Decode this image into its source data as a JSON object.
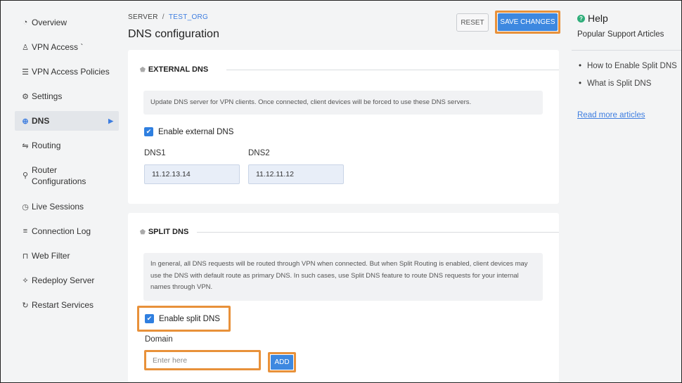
{
  "sidebar": {
    "items": [
      {
        "label": "Overview",
        "icon": "overview-icon",
        "glyph": "◔"
      },
      {
        "label": "VPN Access `",
        "icon": "user-icon",
        "glyph": "♙"
      },
      {
        "label": "VPN Access Policies",
        "icon": "list-icon",
        "glyph": "☰"
      },
      {
        "label": "Settings",
        "icon": "gear-icon",
        "glyph": "⚙"
      },
      {
        "label": "DNS",
        "icon": "globe-icon",
        "glyph": "⊕"
      },
      {
        "label": "Routing",
        "icon": "routing-icon",
        "glyph": "⇋"
      },
      {
        "label": "Router Configurations",
        "icon": "wrench-icon",
        "glyph": "⚲"
      },
      {
        "label": "Live Sessions",
        "icon": "clock-icon",
        "glyph": "◷"
      },
      {
        "label": "Connection Log",
        "icon": "log-icon",
        "glyph": "≡"
      },
      {
        "label": "Web Filter",
        "icon": "lock-icon",
        "glyph": "⊓"
      },
      {
        "label": "Redeploy Server",
        "icon": "redeploy-icon",
        "glyph": "⟡"
      },
      {
        "label": "Restart Services",
        "icon": "restart-icon",
        "glyph": "↻"
      }
    ],
    "active": "DNS"
  },
  "header": {
    "breadcrumb_root": "SERVER",
    "breadcrumb_sep": "/",
    "breadcrumb_current": "TEST_ORG",
    "title": "DNS configuration",
    "reset_label": "RESET",
    "save_label": "SAVE CHANGES"
  },
  "external_dns": {
    "heading": "EXTERNAL DNS",
    "info": "Update DNS server for VPN clients. Once connected, client devices will be forced to use these DNS servers.",
    "enable_label": "Enable external DNS",
    "enabled": true,
    "dns1_label": "DNS1",
    "dns1_value": "11.12.13.14",
    "dns2_label": "DNS2",
    "dns2_value": "11.12.11.12"
  },
  "split_dns": {
    "heading": "SPLIT DNS",
    "info": "In general, all DNS requests will be routed through VPN when connected. But when Split Routing is enabled, client devices may use the DNS with default route as primary DNS. In such cases, use Split DNS feature to route DNS requests for your internal names through VPN.",
    "enable_label": "Enable split DNS",
    "enabled": true,
    "domain_label": "Domain",
    "domain_placeholder": "Enter here",
    "add_label": "ADD"
  },
  "help": {
    "title": "Help",
    "subtitle": "Popular Support Articles",
    "articles": [
      "How to Enable Split DNS",
      "What is Split DNS"
    ],
    "more_label": "Read more articles"
  },
  "colors": {
    "accent": "#3d88e0",
    "highlight": "#e8913a",
    "help_icon": "#2fae7a"
  }
}
